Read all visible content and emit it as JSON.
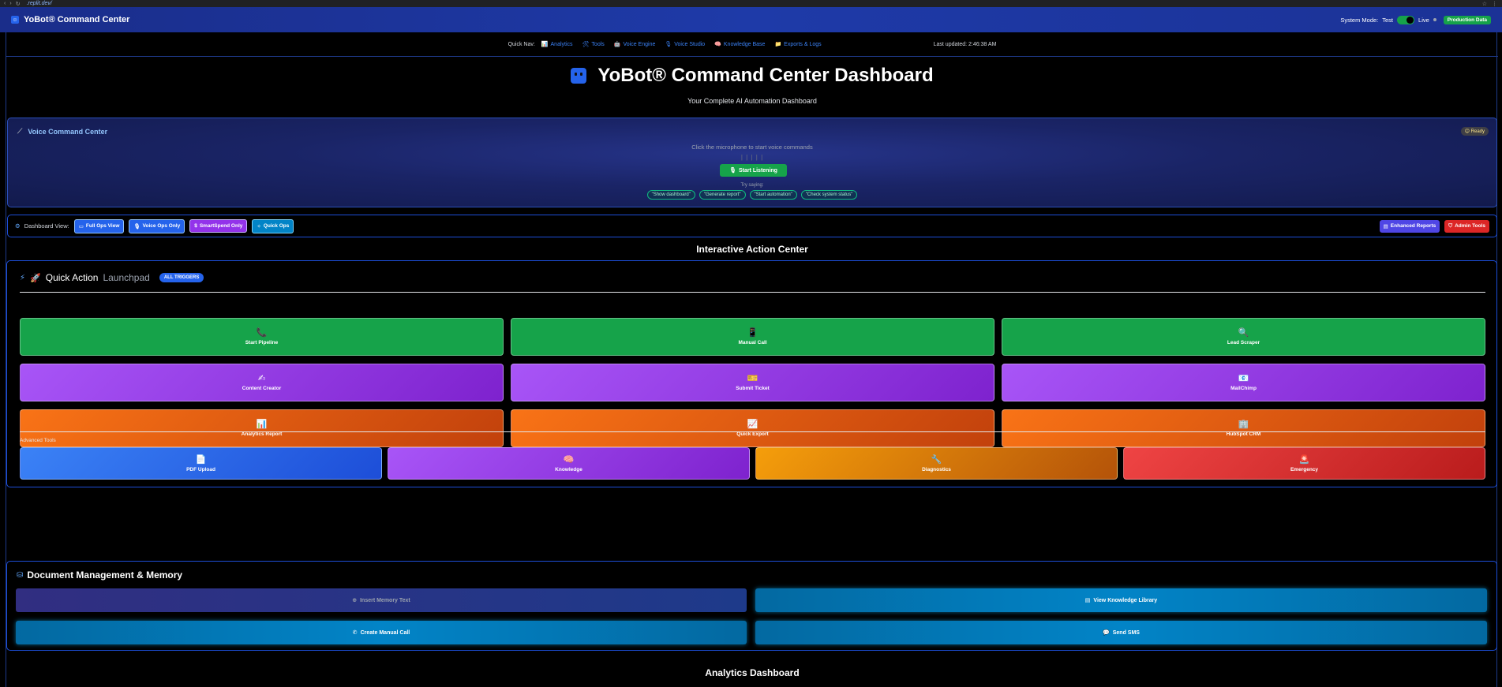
{
  "browser": {
    "url": ".replit.dev/"
  },
  "header": {
    "app_title": "YoBot® Command Center",
    "system_mode_label": "System Mode:",
    "mode_test": "Test",
    "mode_live": "Live",
    "production_badge": "Production Data"
  },
  "quick_nav": {
    "label": "Quick Nav:",
    "links": [
      {
        "icon": "📊",
        "label": "Analytics"
      },
      {
        "icon": "🛠",
        "label": "Tools"
      },
      {
        "icon": "🤖",
        "label": "Voice Engine"
      },
      {
        "icon": "🎙",
        "label": "Voice Studio"
      },
      {
        "icon": "🧠",
        "label": "Knowledge Base"
      },
      {
        "icon": "📁",
        "label": "Exports & Logs"
      }
    ],
    "last_updated": "Last updated: 2:46:38 AM"
  },
  "page": {
    "title": "YoBot® Command Center Dashboard",
    "subtitle": "Your Complete AI Automation Dashboard"
  },
  "voice": {
    "title": "Voice Command Center",
    "status": "😊 Ready",
    "hint": "Click the microphone to start voice commands",
    "bars": "| | | | |",
    "button": "Start Listening",
    "try_label": "Try saying:",
    "examples": [
      "\"Show dashboard\"",
      "\"Generate report\"",
      "\"Start automation\"",
      "\"Check system status\""
    ]
  },
  "view_bar": {
    "label": "Dashboard View:",
    "views": [
      "Full Ops View",
      "Voice Ops Only",
      "SmartSpend Only",
      "Quick Ops"
    ],
    "enhanced_reports": "Enhanced Reports",
    "admin_tools": "Admin Tools"
  },
  "action_center": {
    "title": "Interactive Action Center",
    "launchpad_title_a": "Quick Action",
    "launchpad_title_b": "Launchpad",
    "badge": "ALL TRIGGERS",
    "actions": [
      {
        "icon": "📞",
        "label": "Start Pipeline"
      },
      {
        "icon": "📱",
        "label": "Manual Call"
      },
      {
        "icon": "🔍",
        "label": "Lead Scraper"
      },
      {
        "icon": "✍",
        "label": "Content Creator"
      },
      {
        "icon": "🎫",
        "label": "Submit Ticket"
      },
      {
        "icon": "📧",
        "label": "MailChimp"
      },
      {
        "icon": "📊",
        "label": "Analytics Report"
      },
      {
        "icon": "📈",
        "label": "Quick Export"
      },
      {
        "icon": "🏢",
        "label": "HubSpot CRM"
      }
    ],
    "advanced_label": "Advanced Tools",
    "advanced": [
      {
        "icon": "📄",
        "label": "PDF Upload"
      },
      {
        "icon": "🧠",
        "label": "Knowledge"
      },
      {
        "icon": "🔧",
        "label": "Diagnostics"
      },
      {
        "icon": "🚨",
        "label": "Emergency"
      }
    ]
  },
  "documents": {
    "title": "Document Management & Memory",
    "insert_memory": "Insert Memory Text",
    "view_library": "View Knowledge Library",
    "create_call": "Create Manual Call",
    "send_sms": "Send SMS"
  },
  "analytics_title": "Analytics Dashboard"
}
